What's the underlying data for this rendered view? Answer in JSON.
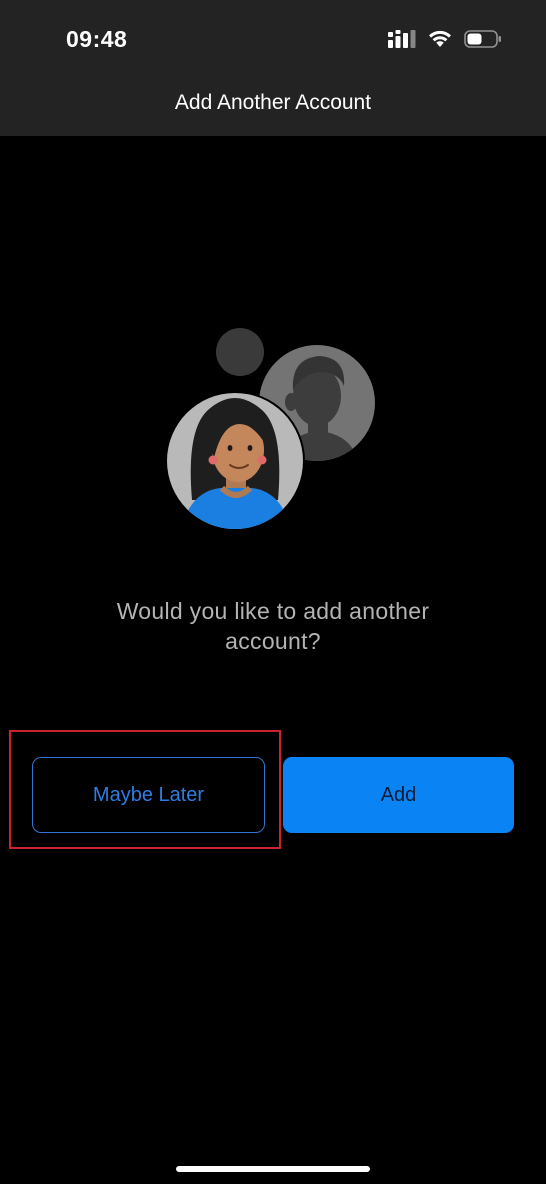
{
  "status_bar": {
    "time": "09:48",
    "icons": [
      "cellular-signal-icon",
      "wifi-icon",
      "battery-icon"
    ]
  },
  "header": {
    "title": "Add Another Account"
  },
  "main": {
    "illustration": "account-avatars-illustration",
    "question": "Would you like to add another account?"
  },
  "actions": {
    "later_label": "Maybe Later",
    "add_label": "Add"
  },
  "colors": {
    "background": "#000000",
    "header_background": "#232323",
    "accent": "#0a84f4",
    "highlight": "#c9232b"
  }
}
